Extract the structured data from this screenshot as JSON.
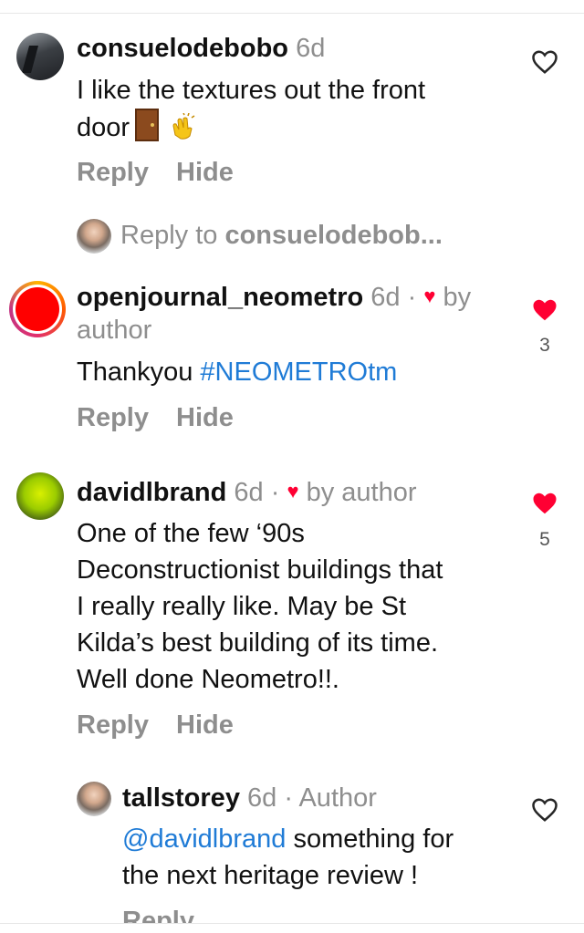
{
  "comments": [
    {
      "username": "consuelodebobo",
      "time": "6d",
      "text_line1": "I like the textures out the front",
      "text_line2": "door",
      "reply_label": "Reply",
      "hide_label": "Hide"
    },
    {
      "username": "openjournal_neometro",
      "time": "6d ·",
      "liked_by": "by",
      "liked_by_2": "author",
      "text": "Thankyou",
      "hashtag": "#NEOMETROtm",
      "likes": "3",
      "reply_label": "Reply",
      "hide_label": "Hide"
    },
    {
      "username": "davidlbrand",
      "time": "6d ·",
      "liked_by": "by author",
      "lines": [
        "One of the few ‘90s",
        "Deconstructionist buildings that",
        "I really really like. May be St",
        "Kilda’s best building of its time.",
        "Well done Neometro!!."
      ],
      "likes": "5",
      "reply_label": "Reply",
      "hide_label": "Hide"
    }
  ],
  "reply_to": {
    "prefix": "Reply to",
    "target": "consuelodebob..."
  },
  "nested_reply": {
    "username": "tallstorey",
    "time": "6d ·",
    "role": "Author",
    "mention": "@davidlbrand",
    "text_line1_rest": " something for",
    "text_line2": "the next heritage review !",
    "reply_label": "Reply"
  },
  "colors": {
    "accent_link": "#1f7bd6",
    "like_red": "#ff0033",
    "muted": "#8e8e8e"
  }
}
